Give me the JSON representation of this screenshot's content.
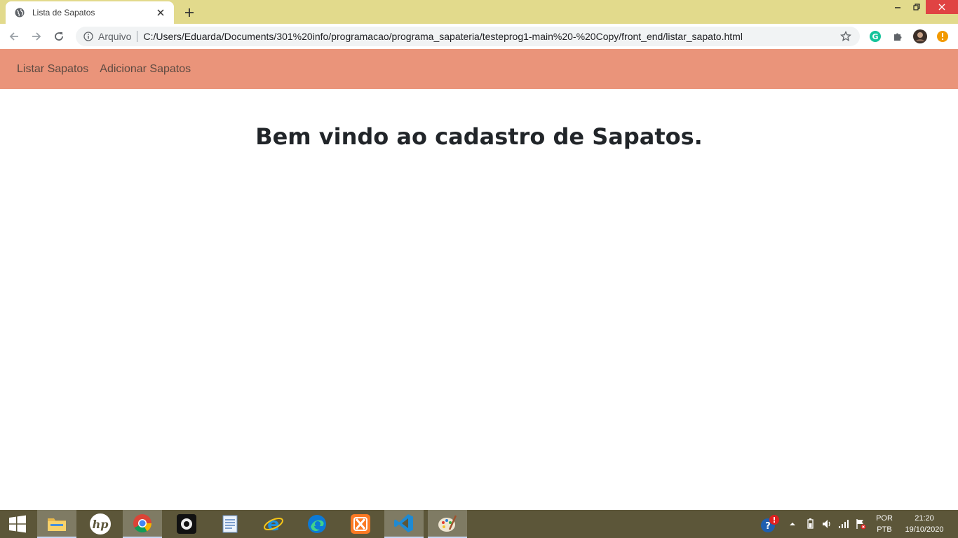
{
  "browser": {
    "tab_title": "Lista de Sapatos",
    "scheme_label": "Arquivo",
    "url": "C:/Users/Eduarda/Documents/301%20info/programacao/programa_sapateria/testeprog1-main%20-%20Copy/front_end/listar_sapato.html",
    "icons": [
      "globe-icon",
      "close-icon",
      "plus-icon",
      "back-icon",
      "forward-icon",
      "reload-icon",
      "info-icon",
      "star-icon",
      "grammarly-icon",
      "puzzle-icon",
      "avatar",
      "update-icon"
    ],
    "colors": {
      "titlebar": "#e2da8c",
      "close_button": "#e04343",
      "update_badge": "#f29900"
    }
  },
  "page": {
    "nav": {
      "links": [
        "Listar Sapatos",
        "Adicionar Sapatos"
      ],
      "background": "#ea947a"
    },
    "headline": "Bem vindo ao cadastro de Sapatos."
  },
  "taskbar": {
    "apps": [
      "windows-start",
      "file-explorer",
      "hp",
      "chrome",
      "camera",
      "notepad",
      "internet-explorer",
      "edge",
      "xampp",
      "vscode",
      "paint"
    ],
    "tray": {
      "lang_top": "POR",
      "lang_bottom": "PTB",
      "time": "21:20",
      "date": "19/10/2020"
    }
  }
}
